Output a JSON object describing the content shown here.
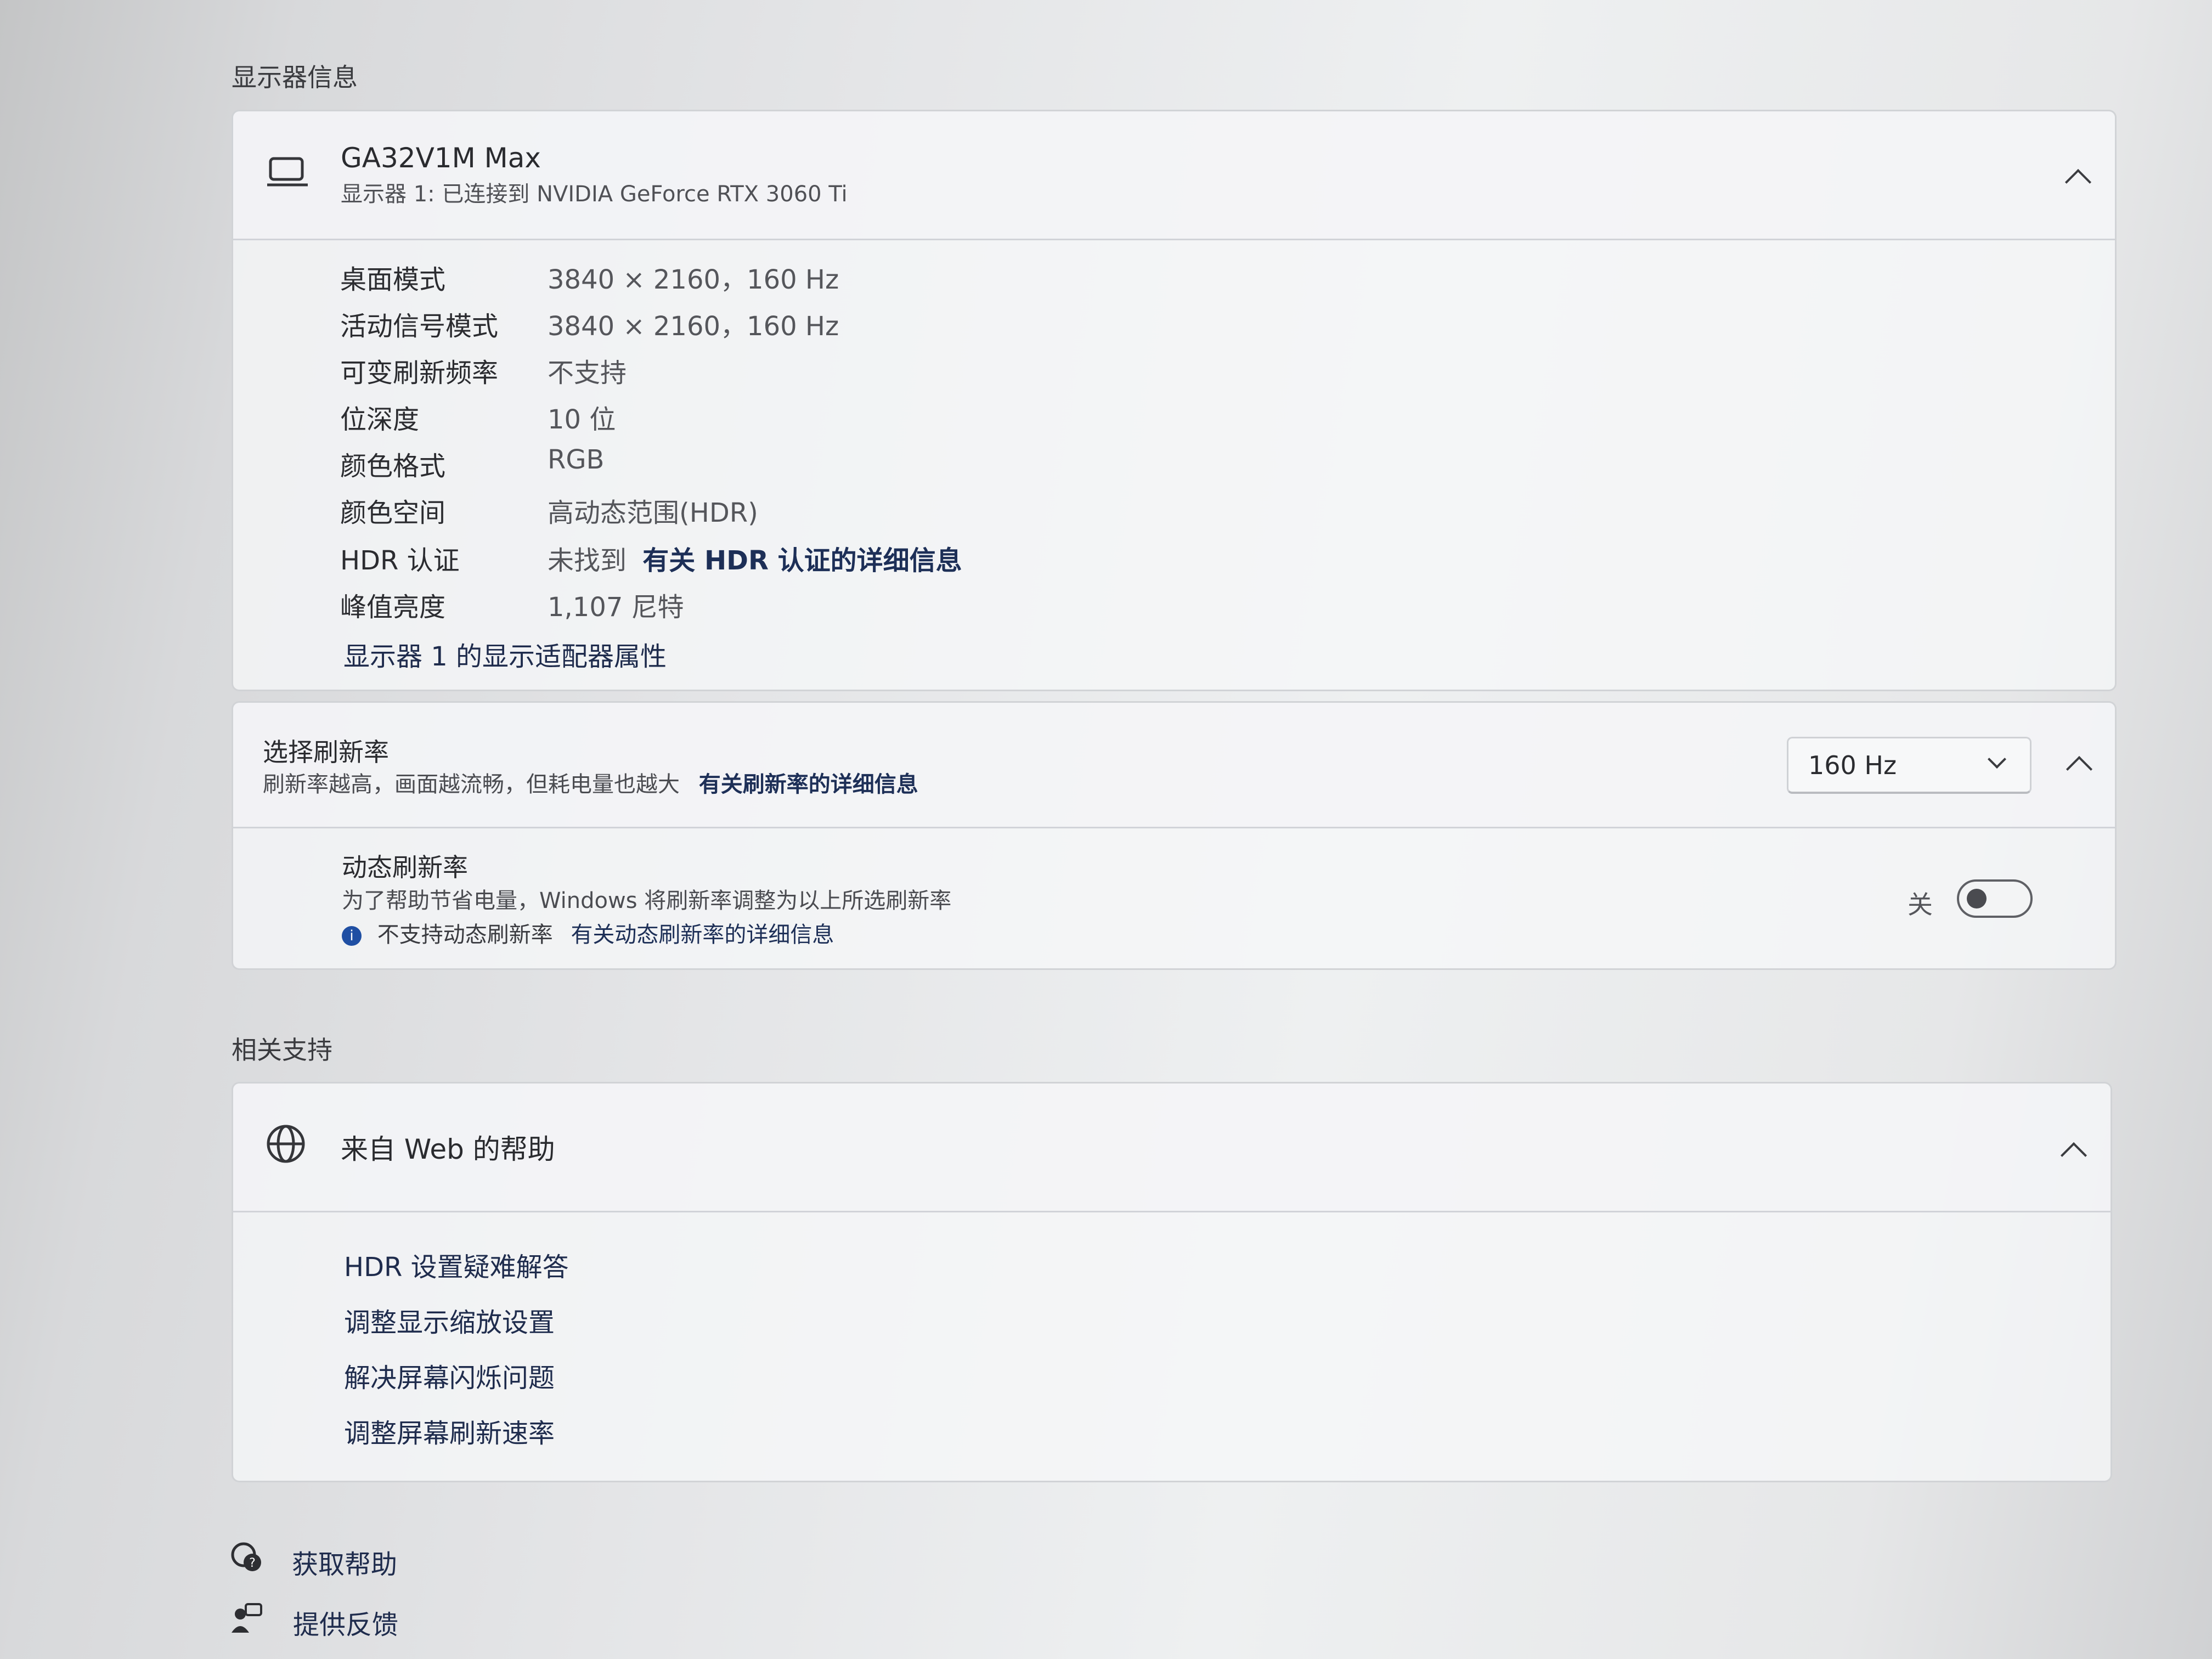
{
  "display_info": {
    "section_title": "显示器信息",
    "monitor_name": "GA32V1M Max",
    "monitor_subtitle": "显示器 1: 已连接到 NVIDIA GeForce RTX 3060 Ti",
    "rows": [
      {
        "label": "桌面模式",
        "value": "3840 × 2160，160 Hz"
      },
      {
        "label": "活动信号模式",
        "value": "3840 × 2160，160 Hz"
      },
      {
        "label": "可变刷新频率",
        "value": "不支持"
      },
      {
        "label": "位深度",
        "value": "10 位"
      },
      {
        "label": "颜色格式",
        "value": "RGB"
      },
      {
        "label": "颜色空间",
        "value": "高动态范围(HDR)"
      },
      {
        "label": "HDR 认证",
        "value": "未找到",
        "link": "有关 HDR 认证的详细信息"
      },
      {
        "label": "峰值亮度",
        "value": "1,107 尼特"
      }
    ],
    "adapter_link": "显示器 1 的显示适配器属性"
  },
  "refresh_rate": {
    "title": "选择刷新率",
    "description": "刷新率越高，画面越流畅，但耗电量也越大",
    "link": "有关刷新率的详细信息",
    "selected": "160 Hz",
    "dynamic": {
      "title": "动态刷新率",
      "description": "为了帮助节省电量，Windows 将刷新率调整为以上所选刷新率",
      "info_text": "不支持动态刷新率",
      "info_link": "有关动态刷新率的详细信息",
      "toggle_label": "关",
      "toggle_on": false
    }
  },
  "related_support": {
    "section_title": "相关支持",
    "web_help_title": "来自 Web 的帮助",
    "links": [
      "HDR 设置疑难解答",
      "调整显示缩放设置",
      "解决屏幕闪烁问题",
      "调整屏幕刷新速率"
    ]
  },
  "footer": {
    "get_help": "获取帮助",
    "feedback": "提供反馈"
  },
  "colors": {
    "link": "#1d2f57",
    "info_icon": "#1f4fa3"
  }
}
